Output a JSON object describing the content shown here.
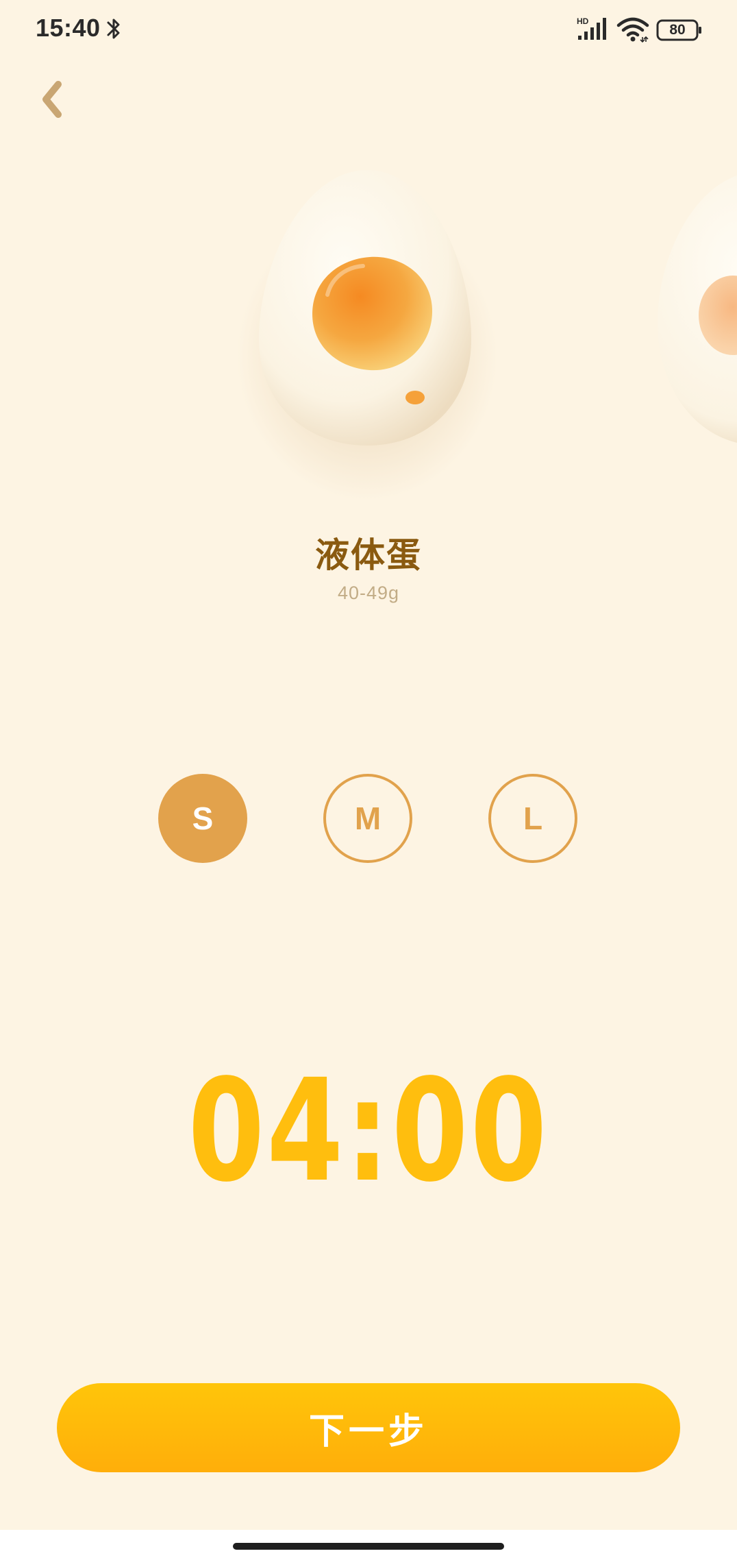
{
  "status_bar": {
    "time": "15:40",
    "battery": "80",
    "icons": [
      "bluetooth-icon",
      "hd-signal-icon",
      "wifi-icon",
      "battery-icon"
    ]
  },
  "navigation": {
    "back_icon": "chevron-left-icon"
  },
  "egg": {
    "name": "液体蛋",
    "weight": "40-49g"
  },
  "sizes": [
    {
      "label": "S",
      "selected": true
    },
    {
      "label": "M",
      "selected": false
    },
    {
      "label": "L",
      "selected": false
    }
  ],
  "timer": {
    "value": "04:00"
  },
  "actions": {
    "next_label": "下一步"
  },
  "colors": {
    "background": "#FDF4E3",
    "accent": "#E2A24C",
    "timer": "#FFBE0E",
    "button": "#FFB90A",
    "title": "#8A5A10"
  }
}
